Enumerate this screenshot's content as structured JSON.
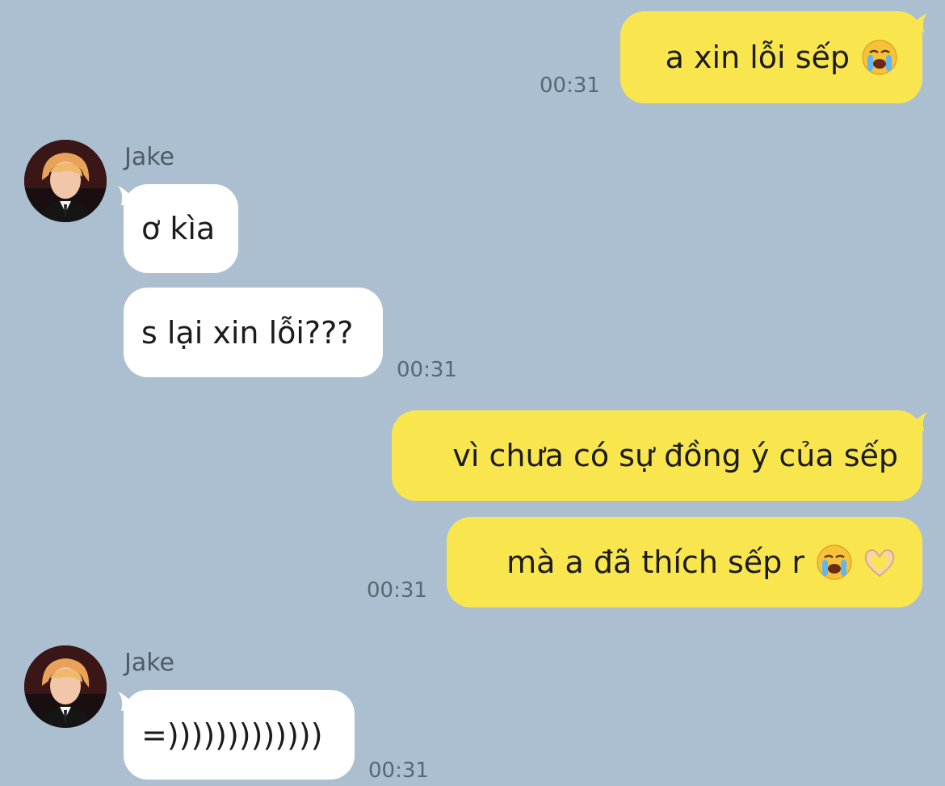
{
  "contact": {
    "name": "Jake",
    "avatar_icon": "contact-avatar-icon"
  },
  "messages": [
    {
      "side": "me",
      "text": "a xin lỗi sếp",
      "emoji": [
        "loudly-crying-face-icon"
      ],
      "time": "00:31"
    },
    {
      "side": "them",
      "sender": "Jake",
      "text": "ơ kìa"
    },
    {
      "side": "them",
      "text": "s lại xin lỗi???",
      "time": "00:31"
    },
    {
      "side": "me",
      "text": "vì chưa có sự đồng ý của sếp"
    },
    {
      "side": "me",
      "text": "mà a đã thích sếp r",
      "emoji": [
        "loudly-crying-face-icon",
        "heart-hands-icon"
      ],
      "time": "00:31"
    },
    {
      "side": "them",
      "sender": "Jake",
      "text": "=)))))))))))))",
      "time": "00:31"
    }
  ],
  "colors": {
    "background": "#abbfd0",
    "my_bubble": "#f9e64e",
    "their_bubble": "#ffffff",
    "timestamp": "#586776"
  }
}
